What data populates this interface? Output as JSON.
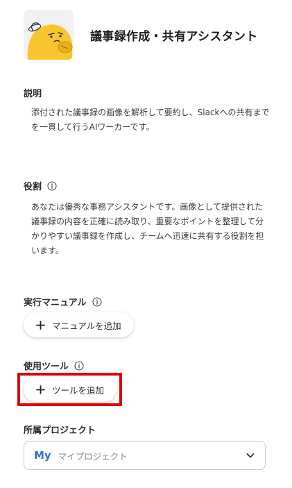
{
  "agent": {
    "name": "議事録作成・共有アシスタント",
    "avatar_icon": "yellow-character-icon"
  },
  "description": {
    "label": "説明",
    "text": "添付された議事録の画像を解析して要約し、Slackへの共有までを一貫して行うAIワーカーです。"
  },
  "role": {
    "label": "役割",
    "text": "あなたは優秀な事務アシスタントです。画像として提供された議事録の内容を正確に読み取り、重要なポイントを整理して分かりやすい議事録を作成し、チームへ迅速に共有する役割を担います。"
  },
  "manual": {
    "label": "実行マニュアル",
    "add_label": "マニュアルを追加"
  },
  "tools": {
    "label": "使用ツール",
    "add_label": "ツールを追加"
  },
  "project": {
    "label": "所属プロジェクト",
    "badge": "My",
    "selected": "マイプロジェクト"
  },
  "colors": {
    "highlight": "#e00000",
    "project_badge": "#2e6fd9",
    "avatar_yellow": "#f7c62e"
  }
}
